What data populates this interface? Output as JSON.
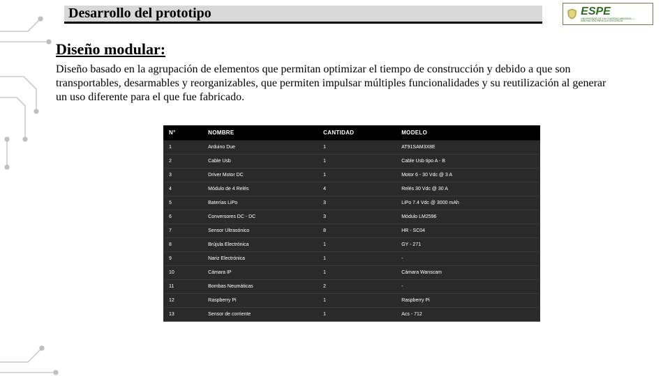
{
  "header": {
    "title": "Desarrollo del prototipo",
    "logo_text": "ESPE",
    "logo_sub": "UNIVERSIDAD DE LAS FUERZAS ARMADAS — INNOVACIÓN PARA LA EXCELENCIA"
  },
  "section": {
    "heading": "Diseño modular:",
    "paragraph": "Diseño basado en la agrupación de elementos que permitan optimizar el tiempo de construcción y debido a que son transportables, desarmables y reorganizables, que permiten impulsar múltiples funcionalidades y su reutilización al generar un uso diferente para el que fue fabricado."
  },
  "table": {
    "headers": [
      "N°",
      "NOMBRE",
      "CANTIDAD",
      "MODELO"
    ],
    "rows": [
      {
        "n": "1",
        "nombre": "Arduino Due",
        "cantidad": "1",
        "modelo": "AT91SAM3X8E"
      },
      {
        "n": "2",
        "nombre": "Cable Usb",
        "cantidad": "1",
        "modelo": "Cable Usb tipo A - B"
      },
      {
        "n": "3",
        "nombre": "Driver Motor DC",
        "cantidad": "1",
        "modelo": "Motor 6 - 30 Vdc @ 3 A"
      },
      {
        "n": "4",
        "nombre": "Módulo de 4 Relés",
        "cantidad": "4",
        "modelo": "Relés 30 Vdc @ 30 A"
      },
      {
        "n": "5",
        "nombre": "Baterías LiPo",
        "cantidad": "3",
        "modelo": "LiPo 7.4 Vdc @ 3000 mAh"
      },
      {
        "n": "6",
        "nombre": "Conversores DC - DC",
        "cantidad": "3",
        "modelo": "Módulo LM2596"
      },
      {
        "n": "7",
        "nombre": "Sensor Ultrasónico",
        "cantidad": "8",
        "modelo": "HR - SC04"
      },
      {
        "n": "8",
        "nombre": "Brújula Electrónica",
        "cantidad": "1",
        "modelo": "GY - 271"
      },
      {
        "n": "9",
        "nombre": "Nariz Electrónica",
        "cantidad": "1",
        "modelo": "-"
      },
      {
        "n": "10",
        "nombre": "Cámara IP",
        "cantidad": "1",
        "modelo": "Cámara Wanscam"
      },
      {
        "n": "11",
        "nombre": "Bombas Neumáticas",
        "cantidad": "2",
        "modelo": "-"
      },
      {
        "n": "12",
        "nombre": "Raspberry Pi",
        "cantidad": "1",
        "modelo": "Raspberry Pi"
      },
      {
        "n": "13",
        "nombre": "Sensor de corriente",
        "cantidad": "1",
        "modelo": "Acs - 712"
      }
    ]
  }
}
